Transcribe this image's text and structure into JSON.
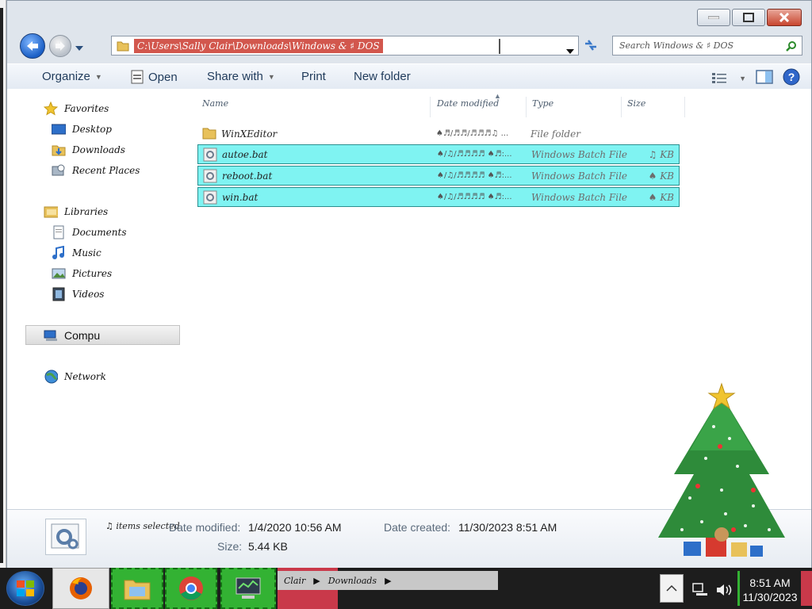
{
  "address_bar": {
    "path": "C:\\Users\\Sally Clair\\Downloads\\Windows & ♯ DOS"
  },
  "search": {
    "placeholder": "Search Windows & ♯ DOS"
  },
  "toolbar": {
    "organize": "Organize",
    "open": "Open",
    "share_with": "Share with",
    "print": "Print",
    "new_folder": "New folder"
  },
  "nav_pane": {
    "favorites": "Favorites",
    "desktop": "Desktop",
    "downloads": "Downloads",
    "recent": "Recent Places",
    "libraries": "Libraries",
    "documents": "Documents",
    "music": "Music",
    "pictures": "Pictures",
    "videos": "Videos",
    "computer": "Compu",
    "network": "Network"
  },
  "columns": {
    "name": "Name",
    "date": "Date modified",
    "type": "Type",
    "size": "Size"
  },
  "files": [
    {
      "name": "WinXEditor",
      "date": "♠♬/♬♬/♬♬♬♫ ...",
      "type": "File folder",
      "size": "",
      "selected": false
    },
    {
      "name": "autoe.bat",
      "date": "♠/♫/♬♬♬♬ ♠♬:...",
      "type": "Windows Batch File",
      "size": "♫ KB",
      "selected": true
    },
    {
      "name": "reboot.bat",
      "date": "♠/♫/♬♬♬♬ ♠♬:...",
      "type": "Windows Batch File",
      "size": "♠ KB",
      "selected": true
    },
    {
      "name": "win.bat",
      "date": "♠/♫/♬♬♬♬ ♠♬:...",
      "type": "Windows Batch File",
      "size": "♠ KB",
      "selected": true
    }
  ],
  "details": {
    "count": "♫ items selected",
    "date_modified_label": "Date modified:",
    "date_modified_value": "1/4/2020 10:56 AM",
    "date_created_label": "Date created:",
    "date_created_value": "11/30/2023 8:51 AM",
    "size_label": "Size:",
    "size_value": "5.44 KB"
  },
  "taskbar": {
    "breadcrumb": [
      "Clair",
      "Downloads"
    ],
    "time": "8:51 AM",
    "date": "11/30/2023"
  },
  "colors": {
    "selection": "#7ff3f2",
    "address_highlight": "#d2574d",
    "task_green": "#33b233",
    "task_red": "#c9394a"
  }
}
